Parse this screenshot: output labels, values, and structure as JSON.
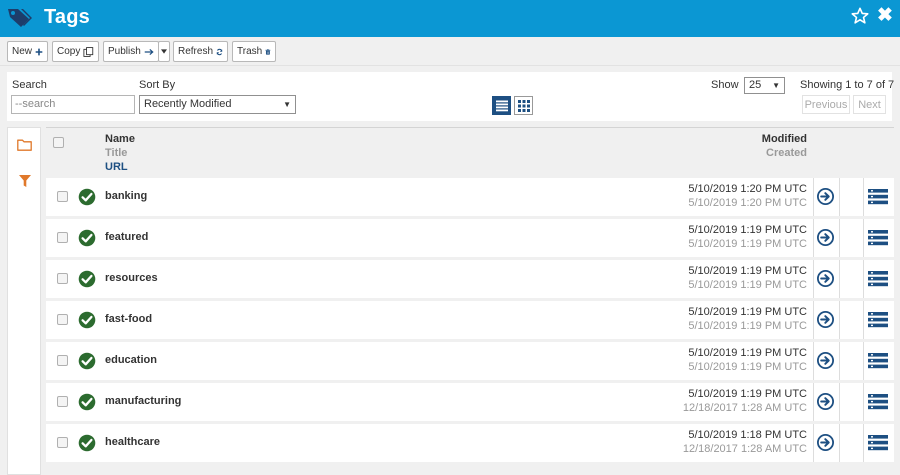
{
  "app": {
    "title": "Tags",
    "close_glyph": "✖"
  },
  "toolbar": {
    "new_label": "New",
    "copy_label": "Copy",
    "publish_label": "Publish",
    "refresh_label": "Refresh",
    "trash_label": "Trash"
  },
  "filters": {
    "search_label": "Search",
    "search_placeholder": "--search",
    "sort_label": "Sort By",
    "sort_value": "Recently Modified",
    "show_label": "Show",
    "show_value": "25",
    "showing_text": "Showing 1 to 7 of 7",
    "previous_label": "Previous",
    "next_label": "Next"
  },
  "table": {
    "headers": {
      "name": "Name",
      "title": "Title",
      "url": "URL",
      "modified": "Modified",
      "created": "Created"
    },
    "rows": [
      {
        "name": "banking",
        "modified": "5/10/2019 1:20 PM UTC",
        "created": "5/10/2019 1:20 PM UTC"
      },
      {
        "name": "featured",
        "modified": "5/10/2019 1:19 PM UTC",
        "created": "5/10/2019 1:19 PM UTC"
      },
      {
        "name": "resources",
        "modified": "5/10/2019 1:19 PM UTC",
        "created": "5/10/2019 1:19 PM UTC"
      },
      {
        "name": "fast-food",
        "modified": "5/10/2019 1:19 PM UTC",
        "created": "5/10/2019 1:19 PM UTC"
      },
      {
        "name": "education",
        "modified": "5/10/2019 1:19 PM UTC",
        "created": "5/10/2019 1:19 PM UTC"
      },
      {
        "name": "manufacturing",
        "modified": "5/10/2019 1:19 PM UTC",
        "created": "12/18/2017 1:28 AM UTC"
      },
      {
        "name": "healthcare",
        "modified": "5/10/2019 1:18 PM UTC",
        "created": "12/18/2017 1:28 AM UTC"
      }
    ]
  },
  "colors": {
    "header_blue": "#0b97d3",
    "navy": "#1d4f82",
    "status_green": "#2c6b2f",
    "rail_orange": "#e0782a"
  },
  "icons": {
    "app": "tag-icon",
    "favorite": "star-icon",
    "close": "close-icon",
    "new": "plus-icon",
    "copy": "copy-icon",
    "publish": "arrow-right-icon",
    "refresh": "refresh-icon",
    "trash": "trash-icon",
    "status": "check-circle-icon",
    "go": "arrow-circle-right-icon",
    "menu": "list-menu-icon"
  }
}
